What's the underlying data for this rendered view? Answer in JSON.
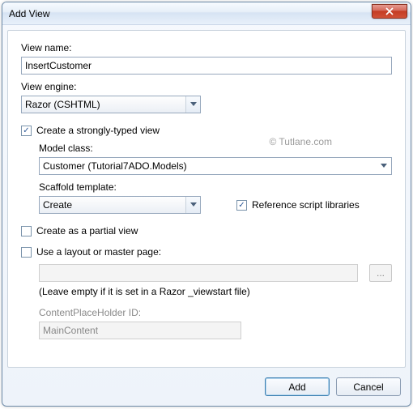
{
  "title": "Add View",
  "watermark": "© Tutlane.com",
  "labels": {
    "viewName": "View name:",
    "viewEngine": "View engine:",
    "strongTyped": "Create a strongly-typed view",
    "modelClass": "Model class:",
    "scaffold": "Scaffold template:",
    "refScript": "Reference script libraries",
    "partial": "Create as a partial view",
    "useLayout": "Use a layout or master page:",
    "layoutHint": "(Leave empty if it is set in a Razor _viewstart file)",
    "cph": "ContentPlaceHolder ID:"
  },
  "values": {
    "viewName": "InsertCustomer",
    "viewEngine": "Razor (CSHTML)",
    "modelClass": "Customer (Tutorial7ADO.Models)",
    "scaffold": "Create",
    "layoutPath": "",
    "cph": "MainContent"
  },
  "checks": {
    "strongTyped": true,
    "refScript": true,
    "partial": false,
    "useLayout": false
  },
  "buttons": {
    "browse": "...",
    "add": "Add",
    "cancel": "Cancel"
  }
}
